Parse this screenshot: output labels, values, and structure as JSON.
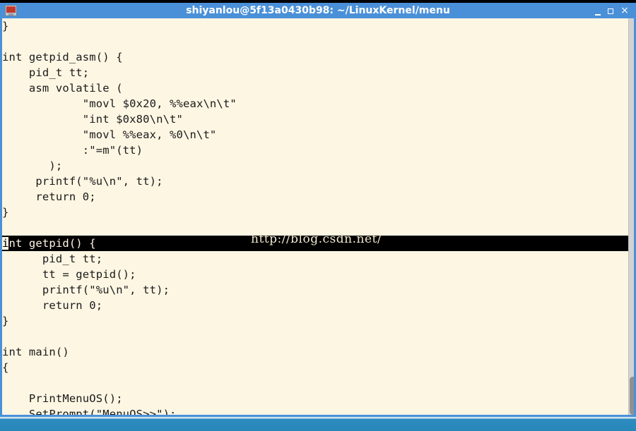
{
  "window": {
    "title": "shiyanlou@5f13a0430b98: ~/LinuxKernel/menu",
    "icon_name": "terminal-icon",
    "controls": {
      "minimize_label": "_",
      "maximize_label": "□",
      "close_label": "×"
    },
    "accent_color": "#4a90d9",
    "terminal_bg": "#fdf6e3",
    "terminal_fg": "#1a1a1a"
  },
  "editor": {
    "watermark": "http://blog.csdn.net/",
    "cursor_char": "i",
    "highlight_line_index": 14,
    "lines": [
      "}",
      "",
      "int getpid_asm() {",
      "    pid_t tt;",
      "    asm volatile (",
      "            \"movl $0x20, %%eax\\n\\t\"",
      "            \"int $0x80\\n\\t\"",
      "            \"movl %%eax, %0\\n\\t\"",
      "            :\"=m\"(tt)",
      "       );",
      "     printf(\"%u\\n\", tt);",
      "     return 0;",
      "}",
      "",
      "int getpid() {",
      "      pid_t tt;",
      "      tt = getpid();",
      "      printf(\"%u\\n\", tt);",
      "      return 0;",
      "}",
      "",
      "int main()",
      "{",
      "",
      "    PrintMenuOS();",
      "    SetPrompt(\"MenuOS>>\");"
    ]
  },
  "scrollbar": {
    "thumb_color": "#909090",
    "track_color": "#d3d3d3"
  }
}
